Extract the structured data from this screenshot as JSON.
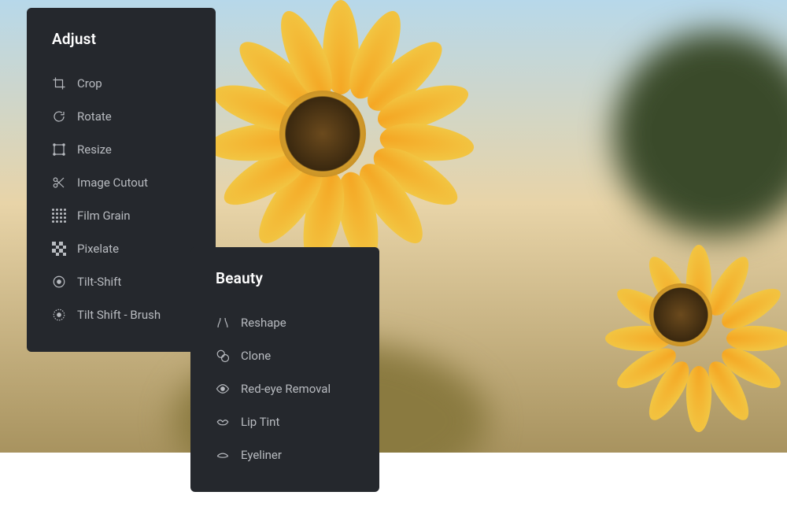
{
  "adjust": {
    "title": "Adjust",
    "items": [
      {
        "label": "Crop",
        "icon": "crop-icon"
      },
      {
        "label": "Rotate",
        "icon": "rotate-icon"
      },
      {
        "label": "Resize",
        "icon": "resize-icon"
      },
      {
        "label": "Image Cutout",
        "icon": "scissors-icon"
      },
      {
        "label": "Film Grain",
        "icon": "grain-icon"
      },
      {
        "label": "Pixelate",
        "icon": "pixelate-icon"
      },
      {
        "label": "Tilt-Shift",
        "icon": "tilt-shift-icon"
      },
      {
        "label": "Tilt Shift - Brush",
        "icon": "tilt-shift-brush-icon"
      }
    ]
  },
  "beauty": {
    "title": "Beauty",
    "items": [
      {
        "label": "Reshape",
        "icon": "reshape-icon"
      },
      {
        "label": "Clone",
        "icon": "clone-icon"
      },
      {
        "label": "Red-eye Removal",
        "icon": "redeye-icon"
      },
      {
        "label": "Lip Tint",
        "icon": "lips-icon"
      },
      {
        "label": "Eyeliner",
        "icon": "eyeliner-icon"
      }
    ]
  }
}
